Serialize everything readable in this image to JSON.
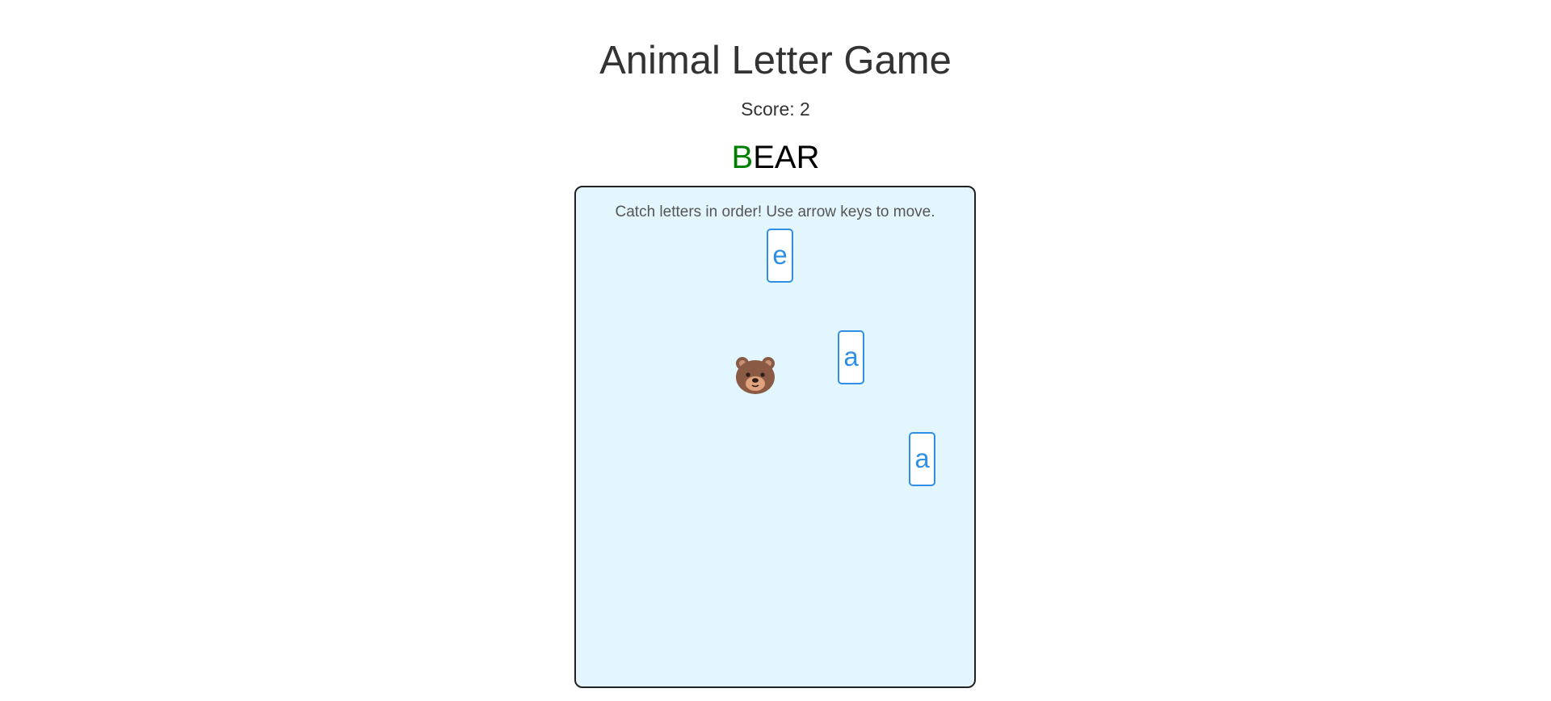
{
  "game": {
    "title": "Animal Letter Game",
    "score_text": "Score: 2",
    "target_word": "BEAR",
    "caught_letters": 1,
    "caught_color": "#008000",
    "pending_color": "#000000"
  },
  "board": {
    "instructions": "Catch letters in order! Use arrow keys to move.",
    "background": "#e3f6fd",
    "player": {
      "animal": "bear",
      "icon": "bear-face-icon"
    },
    "falling_letters": [
      {
        "letter": "e"
      },
      {
        "letter": "a"
      },
      {
        "letter": "a"
      }
    ]
  }
}
